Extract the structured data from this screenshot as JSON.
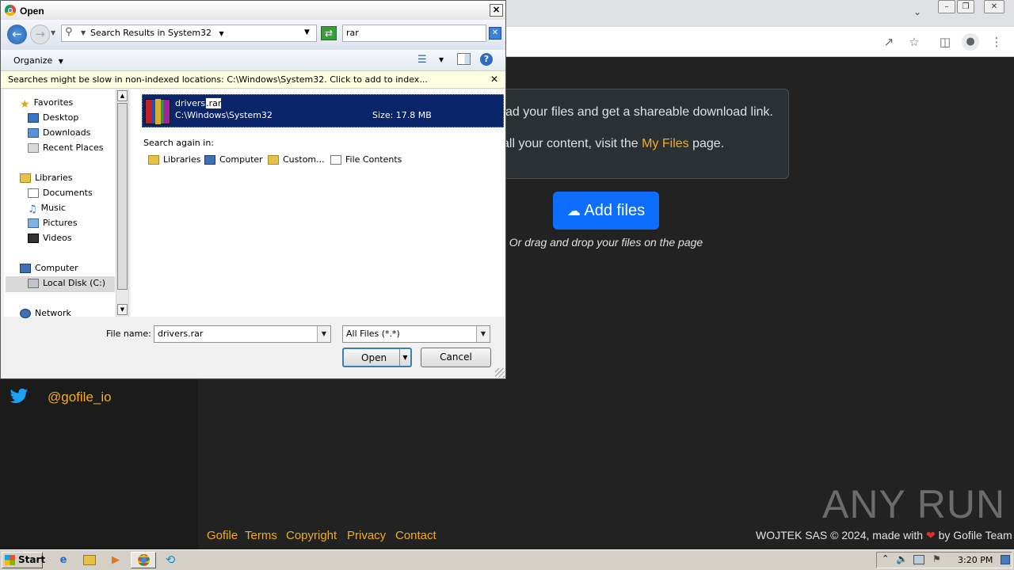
{
  "dialog": {
    "title": "Open",
    "address": "Search Results in System32",
    "search_value": "rar",
    "organize_label": "Organize",
    "info_bar": "Searches might be slow in non-indexed locations: C:\\Windows\\System32. Click to add to index...",
    "nav": {
      "favorites": "Favorites",
      "desktop": "Desktop",
      "downloads": "Downloads",
      "recent_places": "Recent Places",
      "libraries": "Libraries",
      "documents": "Documents",
      "music": "Music",
      "pictures": "Pictures",
      "videos": "Videos",
      "computer": "Computer",
      "local_disk": "Local Disk (C:)",
      "network": "Network"
    },
    "result": {
      "name_base": "drivers",
      "name_ext": ".rar",
      "path": "C:\\Windows\\System32",
      "size": "Size: 17.8 MB"
    },
    "search_again_label": "Search again in:",
    "search_again_options": {
      "libraries": "Libraries",
      "computer": "Computer",
      "custom": "Custom...",
      "file_contents": "File Contents"
    },
    "file_name_label": "File name:",
    "file_name_value": "drivers.rar",
    "file_type_value": "All Files (*.*)",
    "open_label": "Open",
    "cancel_label": "Cancel"
  },
  "page": {
    "info_line1": "ad your files and get a shareable download link.",
    "info_line2_pre": "all your content, visit the ",
    "info_line2_link": "My Files",
    "info_line2_post": " page.",
    "add_files_label": "Add files",
    "drag_text": "Or drag and drop your files on the page",
    "twitter_handle": "@gofile_io",
    "footer_links": {
      "gofile": "Gofile",
      "terms": "Terms",
      "copyright": "Copyright",
      "privacy": "Privacy",
      "contact": "Contact"
    },
    "copyright_pre": "WOJTEK SAS © 2024, made with ",
    "copyright_post": " by Gofile Team",
    "watermark": "ANY RUN"
  },
  "taskbar": {
    "start_label": "Start",
    "clock": "3:20 PM"
  },
  "colors": {
    "accent_blue": "#0d6efd",
    "link_yellow": "#f0ad1e",
    "selection_navy": "#0a246a",
    "heart_red": "#e03131"
  },
  "icons": [
    "chrome-icon",
    "back-arrow-icon",
    "forward-arrow-icon",
    "search-icon",
    "refresh-icon",
    "clear-icon",
    "views-icon",
    "preview-pane-icon",
    "help-icon",
    "close-icon",
    "star-icon",
    "folder-icon",
    "library-icon",
    "computer-icon",
    "disk-icon",
    "network-icon",
    "winrar-icon",
    "file-contents-icon",
    "cloud-upload-icon",
    "twitter-icon",
    "heart-icon",
    "share-icon",
    "bookmark-star-icon",
    "sidepanel-icon",
    "profile-icon",
    "kebab-menu-icon"
  ]
}
